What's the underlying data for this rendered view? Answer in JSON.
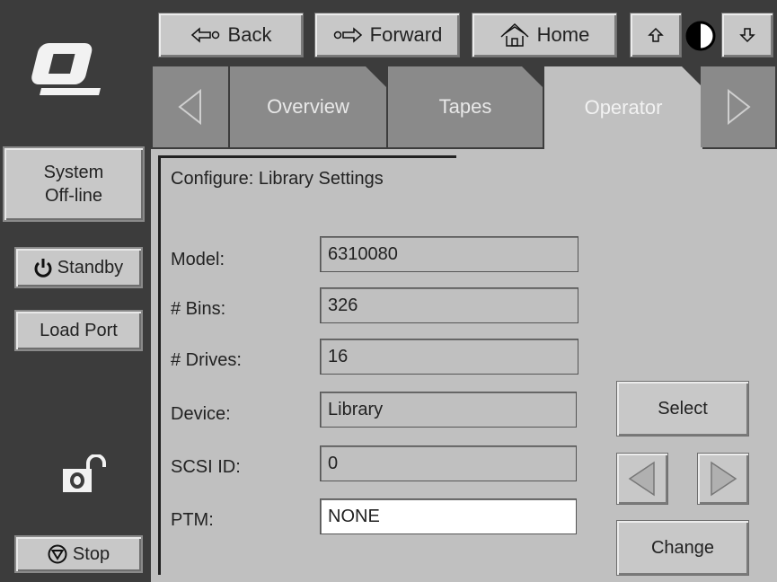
{
  "sidebar": {
    "logo_icon": "quantum-q-logo-icon",
    "system_status_line1": "System",
    "system_status_line2": "Off-line",
    "standby_label": "Standby",
    "standby_icon": "power-icon",
    "load_port_label": "Load Port",
    "lock_icon": "unlocked-padlock-icon",
    "stop_label": "Stop",
    "stop_icon": "stop-icon"
  },
  "nav": {
    "back_label": "Back",
    "forward_label": "Forward",
    "home_label": "Home",
    "up_icon": "arrow-up-icon",
    "contrast_icon": "contrast-icon",
    "down_icon": "arrow-down-icon"
  },
  "tabs": {
    "items": [
      {
        "label": "Overview"
      },
      {
        "label": "Tapes"
      },
      {
        "label": "Operator"
      }
    ],
    "active": "Operator"
  },
  "panel": {
    "title": "Configure: Library Settings",
    "fields": [
      {
        "label": "Model:",
        "value": "6310080"
      },
      {
        "label": "# Bins:",
        "value": "326"
      },
      {
        "label": "# Drives:",
        "value": "16"
      },
      {
        "label": "Device:",
        "value": "Library"
      },
      {
        "label": "SCSI ID:",
        "value": "0"
      },
      {
        "label": "PTM:",
        "value": "NONE"
      }
    ],
    "select_label": "Select",
    "change_label": "Change"
  },
  "colors": {
    "sidebar_bg": "#3c3c3c",
    "panel_bg": "#c0c0c0",
    "tab_inactive": "#8a8a8a",
    "button_face": "#c8c8c8"
  }
}
